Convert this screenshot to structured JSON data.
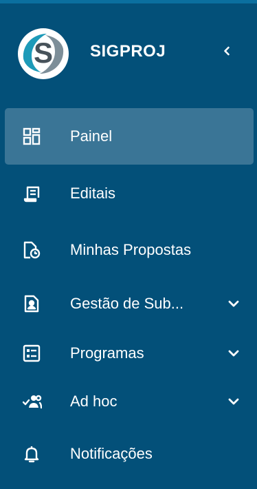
{
  "app": {
    "name": "SIGPROJ"
  },
  "menu": [
    {
      "label": "Painel",
      "icon": "dashboard-icon",
      "active": true,
      "expandable": false
    },
    {
      "label": "Editais",
      "icon": "scroll-document-icon",
      "active": false,
      "expandable": false
    },
    {
      "label": "Minhas Propostas",
      "icon": "document-clock-icon",
      "active": false,
      "expandable": false
    },
    {
      "label": "Gestão de Sub...",
      "icon": "person-document-icon",
      "active": false,
      "expandable": true
    },
    {
      "label": "Programas",
      "icon": "list-box-icon",
      "active": false,
      "expandable": true
    },
    {
      "label": "Ad hoc",
      "icon": "group-check-icon",
      "active": false,
      "expandable": true
    },
    {
      "label": "Notificações",
      "icon": "bell-icon",
      "active": false,
      "expandable": false
    }
  ],
  "colors": {
    "background": "#035079",
    "active": "#3a7596",
    "text": "#ffffff"
  }
}
